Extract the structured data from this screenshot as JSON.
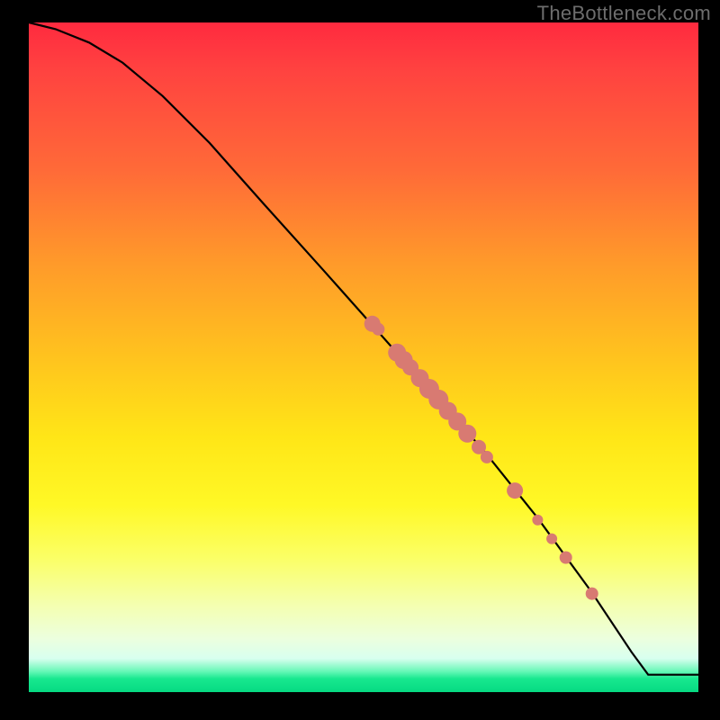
{
  "watermark": "TheBottleneck.com",
  "chart_data": {
    "type": "line",
    "title": "",
    "xlabel": "",
    "ylabel": "",
    "xlim": [
      0,
      100
    ],
    "ylim": [
      0,
      100
    ],
    "grid": false,
    "series": [
      {
        "name": "curve",
        "x": [
          0,
          4,
          9,
          14,
          20,
          27,
          35,
          44,
          52,
          60,
          68,
          76,
          84,
          90,
          92.5,
          95,
          100
        ],
        "y": [
          100,
          99,
          97,
          94,
          89,
          82,
          73,
          63,
          54,
          45,
          36,
          26,
          15,
          6,
          2.6,
          2.6,
          2.6
        ]
      }
    ],
    "markers": [
      {
        "x": 51.3,
        "y": 55.0,
        "r": 9
      },
      {
        "x": 52.2,
        "y": 54.2,
        "r": 7
      },
      {
        "x": 55.0,
        "y": 50.7,
        "r": 10
      },
      {
        "x": 56.0,
        "y": 49.6,
        "r": 10
      },
      {
        "x": 57.0,
        "y": 48.5,
        "r": 9
      },
      {
        "x": 58.4,
        "y": 46.9,
        "r": 10
      },
      {
        "x": 59.8,
        "y": 45.3,
        "r": 11
      },
      {
        "x": 61.2,
        "y": 43.7,
        "r": 11
      },
      {
        "x": 62.6,
        "y": 42.0,
        "r": 10
      },
      {
        "x": 64.0,
        "y": 40.4,
        "r": 10
      },
      {
        "x": 65.5,
        "y": 38.6,
        "r": 10
      },
      {
        "x": 67.2,
        "y": 36.6,
        "r": 8
      },
      {
        "x": 68.4,
        "y": 35.1,
        "r": 7
      },
      {
        "x": 72.6,
        "y": 30.1,
        "r": 9
      },
      {
        "x": 76.0,
        "y": 25.7,
        "r": 6
      },
      {
        "x": 78.1,
        "y": 22.9,
        "r": 6
      },
      {
        "x": 80.2,
        "y": 20.1,
        "r": 7
      },
      {
        "x": 84.1,
        "y": 14.7,
        "r": 7
      }
    ]
  }
}
